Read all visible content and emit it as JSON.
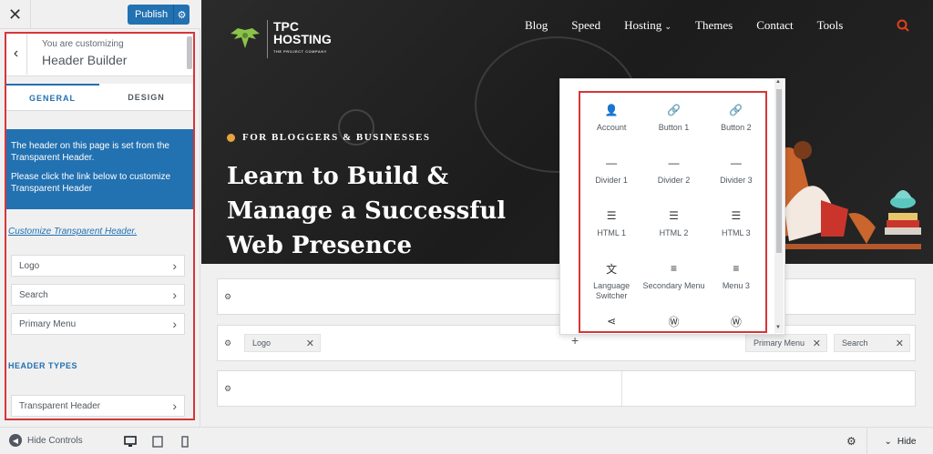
{
  "sidebar": {
    "close_icon": "close-icon",
    "publish_label": "Publish",
    "customizing_label": "You are customizing",
    "panel_title": "Header Builder",
    "tabs": [
      {
        "label": "GENERAL",
        "active": true
      },
      {
        "label": "DESIGN",
        "active": false
      }
    ],
    "notice": {
      "line1": "The header on this page is set from the Transparent Header.",
      "line2": "Please click the link below to customize Transparent Header"
    },
    "notice_link": "Customize Transparent Header.",
    "items": [
      {
        "label": "Logo"
      },
      {
        "label": "Search"
      },
      {
        "label": "Primary Menu"
      }
    ],
    "section_label": "HEADER TYPES",
    "section_items": [
      {
        "label": "Transparent Header"
      }
    ],
    "hide_controls_label": "Hide Controls"
  },
  "preview": {
    "logo": {
      "line1": "TPC",
      "line2": "HOSTING",
      "tagline": "THE PROJECT COMPANY"
    },
    "nav": [
      "Blog",
      "Speed",
      "Hosting",
      "Themes",
      "Contact",
      "Tools"
    ],
    "eyebrow": "FOR BLOGGERS & BUSINESSES",
    "headline": "Learn to Build & Manage a Successful Web Presence",
    "accent_color": "#e7a33e",
    "header_rows": {
      "main_left_chip": "Logo",
      "main_right_chips": [
        "Primary Menu",
        "Search"
      ],
      "add_symbol": "+"
    },
    "picker_items": [
      {
        "label": "Account",
        "icon": "user-icon",
        "glyph": "👤"
      },
      {
        "label": "Button 1",
        "icon": "link-icon",
        "glyph": "🔗"
      },
      {
        "label": "Button 2",
        "icon": "link-icon",
        "glyph": "🔗"
      },
      {
        "label": "Divider 1",
        "icon": "minus-icon",
        "glyph": "—"
      },
      {
        "label": "Divider 2",
        "icon": "minus-icon",
        "glyph": "—"
      },
      {
        "label": "Divider 3",
        "icon": "minus-icon",
        "glyph": "—"
      },
      {
        "label": "HTML 1",
        "icon": "text-icon",
        "glyph": "☰"
      },
      {
        "label": "HTML 2",
        "icon": "text-icon",
        "glyph": "☰"
      },
      {
        "label": "HTML 3",
        "icon": "text-icon",
        "glyph": "☰"
      },
      {
        "label": "Language Switcher",
        "icon": "translate-icon",
        "glyph": "文"
      },
      {
        "label": "Secondary Menu",
        "icon": "menu-icon",
        "glyph": "≡"
      },
      {
        "label": "Menu 3",
        "icon": "menu-icon",
        "glyph": "≡"
      },
      {
        "label": "",
        "icon": "share-icon",
        "glyph": "⋖"
      },
      {
        "label": "",
        "icon": "wordpress-icon",
        "glyph": "Ⓦ"
      },
      {
        "label": "",
        "icon": "wordpress-icon",
        "glyph": "Ⓦ"
      }
    ],
    "hide_label": "Hide"
  }
}
